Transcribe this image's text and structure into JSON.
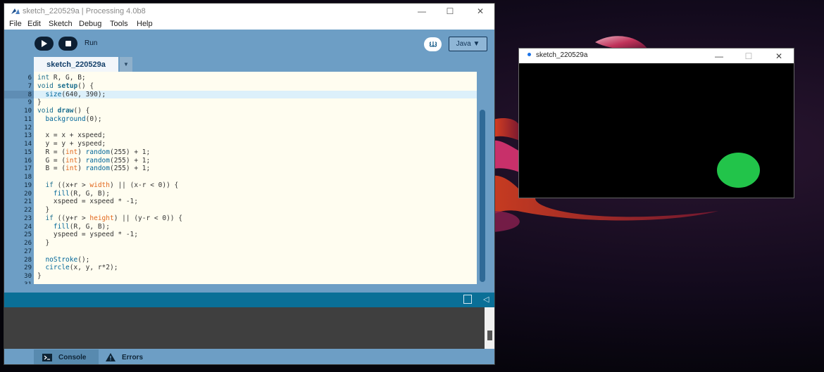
{
  "ide": {
    "title": "sketch_220529a | Processing 4.0b8",
    "controls": {
      "minimize": "—",
      "maximize": "☐",
      "close": "✕"
    },
    "menu": [
      "File",
      "Edit",
      "Sketch",
      "Debug",
      "Tools",
      "Help"
    ],
    "toolbar": {
      "run_icon": "play-icon",
      "stop_icon": "stop-icon",
      "run_label": "Run",
      "debug_icon": "butterfly-icon",
      "mode_label": "Java ▼"
    },
    "tab": {
      "label": "sketch_220529a",
      "menu_arrow": "▼"
    },
    "editor": {
      "current_line": "8",
      "lines": [
        {
          "n": "6",
          "html": "<span class=\"kw\">int</span> R, G, B;"
        },
        {
          "n": "7",
          "html": "<span class=\"kw\">void</span> <span class=\"kb\">setup</span>() {"
        },
        {
          "n": "8",
          "html": "  <span class=\"fn\">size</span>(640, 390);"
        },
        {
          "n": "9",
          "html": "}"
        },
        {
          "n": "10",
          "html": "<span class=\"kw\">void</span> <span class=\"kb\">draw</span>() {"
        },
        {
          "n": "11",
          "html": "  <span class=\"fn\">background</span>(0);"
        },
        {
          "n": "12",
          "html": ""
        },
        {
          "n": "13",
          "html": "  x = x + xspeed;"
        },
        {
          "n": "14",
          "html": "  y = y + yspeed;"
        },
        {
          "n": "15",
          "html": "  R = (<span class=\"ty\">int</span>) <span class=\"fn\">random</span>(255) + 1;"
        },
        {
          "n": "16",
          "html": "  G = (<span class=\"ty\">int</span>) <span class=\"fn\">random</span>(255) + 1;"
        },
        {
          "n": "17",
          "html": "  B = (<span class=\"ty\">int</span>) <span class=\"fn\">random</span>(255) + 1;"
        },
        {
          "n": "18",
          "html": ""
        },
        {
          "n": "19",
          "html": "  <span class=\"kw\">if</span> ((x+r > <span class=\"ty\">width</span>) || (x-r < 0)) {"
        },
        {
          "n": "20",
          "html": "    <span class=\"fn\">fill</span>(R, G, B);"
        },
        {
          "n": "21",
          "html": "    xspeed = xspeed * -1;"
        },
        {
          "n": "22",
          "html": "  }"
        },
        {
          "n": "23",
          "html": "  <span class=\"kw\">if</span> ((y+r > <span class=\"ty\">height</span>) || (y-r < 0)) {"
        },
        {
          "n": "24",
          "html": "    <span class=\"fn\">fill</span>(R, G, B);"
        },
        {
          "n": "25",
          "html": "    yspeed = yspeed * -1;"
        },
        {
          "n": "26",
          "html": "  }"
        },
        {
          "n": "27",
          "html": ""
        },
        {
          "n": "28",
          "html": "  <span class=\"fn\">noStroke</span>();"
        },
        {
          "n": "29",
          "html": "  <span class=\"fn\">circle</span>(x, y, r*2);"
        },
        {
          "n": "30",
          "html": "}"
        },
        {
          "n": "31",
          "html": ""
        }
      ]
    },
    "status": {
      "copy_icon": "copy-icon",
      "collapse_icon": "◁"
    },
    "bottom_tabs": [
      {
        "label": "Console",
        "icon": "terminal-icon"
      },
      {
        "label": "Errors",
        "icon": "warning-icon"
      }
    ]
  },
  "sketch_window": {
    "title": "sketch_220529a",
    "controls": {
      "minimize": "—",
      "maximize": "☐",
      "close": "✕"
    },
    "ball_color": "#22c44a"
  },
  "colors": {
    "ide_chrome": "#6d9ec5",
    "status_bar": "#0a6f97",
    "console_bg": "#3f3f3f"
  }
}
